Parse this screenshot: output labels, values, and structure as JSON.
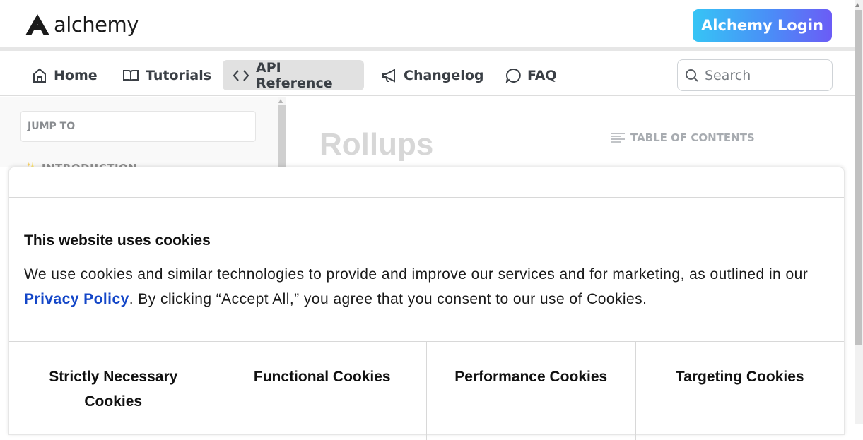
{
  "header": {
    "logo_text": "alchemy",
    "login_button": "Alchemy Login"
  },
  "nav": {
    "items": [
      {
        "label": "Home",
        "icon": "home-icon"
      },
      {
        "label": "Tutorials",
        "icon": "book-icon"
      },
      {
        "label": "API Reference",
        "icon": "code-icon",
        "active": true
      },
      {
        "label": "Changelog",
        "icon": "megaphone-icon"
      },
      {
        "label": "FAQ",
        "icon": "chat-bubble-icon"
      }
    ],
    "search_placeholder": "Search"
  },
  "sidebar": {
    "jump_to": "JUMP TO",
    "first_section": "INTRODUCTION"
  },
  "main": {
    "title": "Rollups",
    "toc_label": "TABLE OF CONTENTS"
  },
  "cookie_banner": {
    "title": "This website uses cookies",
    "text_before_link": "We use cookies and similar technologies to provide and improve our services and for marketing, as outlined in our ",
    "link_text": "Privacy Policy",
    "text_after_link": ". By clicking “Accept All,” you agree that you consent to our use of Cookies.",
    "categories": [
      "Strictly Necessary Cookies",
      "Functional Cookies",
      "Performance Cookies",
      "Targeting Cookies"
    ]
  },
  "colors": {
    "login_gradient_start": "#36c5f5",
    "login_gradient_end": "#6b5cf6",
    "link": "#1447c8",
    "active_tab_bg": "#e1e1e1"
  }
}
